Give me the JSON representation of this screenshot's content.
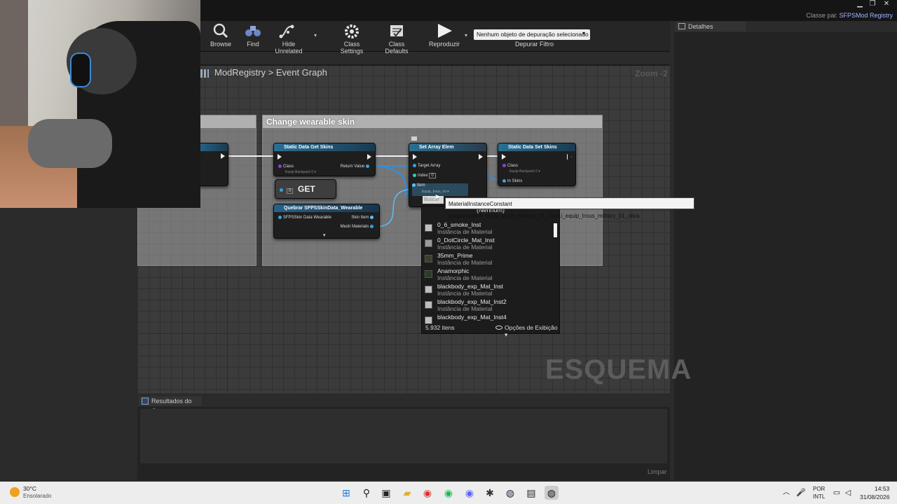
{
  "window": {
    "title_prefix": "Classe pai:",
    "title_class": "SFPSMod Registry",
    "controls": [
      "▁",
      "❐",
      "✕"
    ]
  },
  "toolbar": {
    "items": [
      {
        "label": "Browse",
        "icon": "magnifier-icon"
      },
      {
        "label": "Find",
        "icon": "binoculars-icon"
      },
      {
        "label": "Hide Unrelated",
        "icon": "hide-unrelated-icon"
      },
      {
        "label": "Class Settings",
        "icon": "gear-icon"
      },
      {
        "label": "Class Defaults",
        "icon": "defaults-icon"
      },
      {
        "label": "Reproduzir",
        "icon": "play-icon"
      }
    ],
    "debug_select": "Nenhum objeto de depuração selecionado",
    "debug_filter": "Depurar Filtro"
  },
  "details": {
    "tab": "Detalhes"
  },
  "graph": {
    "breadcrumb": {
      "root": "ModRegistry",
      "separator": ">",
      "current": "Event Graph"
    },
    "zoom": "Zoom -2",
    "watermark": "ESQUEMA",
    "comment_title": "Change wearable skin",
    "get_node": "GET",
    "nodes": {
      "get_skins": {
        "title": "Static Data Get Skins",
        "class_pin": "Class",
        "class_value": "Equip Backpack 0 ▾",
        "return_pin": "Return Value"
      },
      "set_array": {
        "title": "Set Array Elem",
        "target_pin": "Target Array",
        "index_pin": "Index",
        "index_value": "0",
        "item_pin": "Item",
        "item_value": "Equip_trous_mi ▾"
      },
      "set_skins": {
        "title": "Static Data Set Skins",
        "class_pin": "Class",
        "class_value": "Equip Backpack 0 ▾",
        "in_pin": "In Skins"
      },
      "break": {
        "title": "Quebrar SFPSSkinData_Wearable",
        "in_pin": "SFPSSkin Data Wearable",
        "skin_pin": "Skin Item",
        "mesh_pin": "Mesh Materials"
      }
    }
  },
  "tooltip": "MaterialInstanceConstant /roupamilitar/i_equip_trous_military_01_oliva.i_equip_trous_military_01_oliva",
  "popup": {
    "search_placeholder": "Buscar",
    "none": "(Nenhum)",
    "items": [
      {
        "name": "0_6_smoke_Inst",
        "type": "Instância de Material",
        "swatch": "#bfbfbf"
      },
      {
        "name": "0_DotCircle_Mat_Inst",
        "type": "Instância de Material",
        "swatch": "#9a9a9a"
      },
      {
        "name": "35mm_Prime",
        "type": "Instância de Material",
        "swatch": "#3e3e2a"
      },
      {
        "name": "Anamorphic",
        "type": "Instância de Material",
        "swatch": "#2f3a28"
      },
      {
        "name": "blackbody_exp_Mat_Inst",
        "type": "Instância de Material",
        "swatch": "#c8c8c8"
      },
      {
        "name": "blackbody_exp_Mat_Inst2",
        "type": "Instância de Material",
        "swatch": "#c8c8c8"
      },
      {
        "name": "blackbody_exp_Mat_Inst4",
        "type": "",
        "swatch": "#c8c8c8"
      }
    ],
    "count": "5.932 itens",
    "view_options": "Opções de Exibição ▾"
  },
  "results": {
    "tab": "Resultados do Cor",
    "clear": "Limpar"
  },
  "taskbar": {
    "weather_temp": "30°C",
    "weather_desc": "Ensolarado",
    "lang": "POR",
    "layout": "INTL",
    "time": "14:53",
    "date": "31/08/2026"
  }
}
